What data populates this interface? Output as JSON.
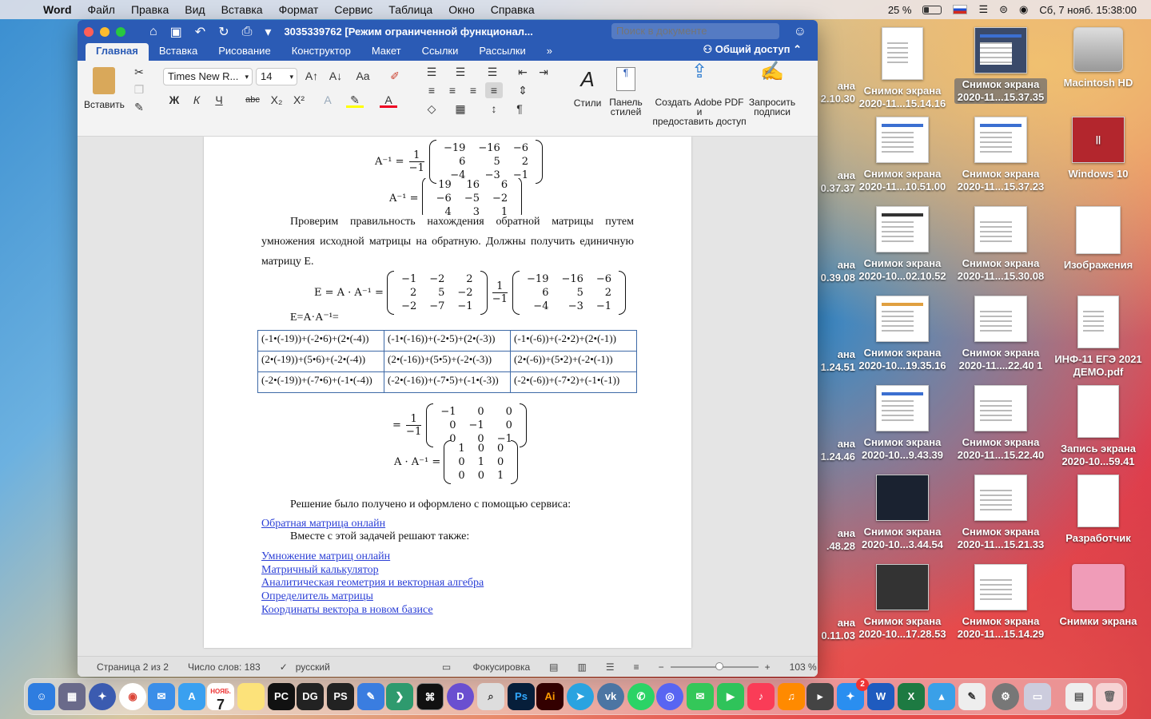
{
  "menubar": {
    "app": "Word",
    "items": [
      "Файл",
      "Правка",
      "Вид",
      "Вставка",
      "Формат",
      "Сервис",
      "Таблица",
      "Окно",
      "Справка"
    ],
    "battery": "25 %",
    "datetime": "Сб, 7 нояб.  15:38:00"
  },
  "window": {
    "title": "3035339762 [Режим ограниченной функционал...",
    "search_placeholder": "Поиск в документе"
  },
  "tabs": [
    "Главная",
    "Вставка",
    "Рисование",
    "Конструктор",
    "Макет",
    "Ссылки",
    "Рассылки"
  ],
  "share": "Общий доступ",
  "ribbon": {
    "paste": "Вставить",
    "font": "Times New R...",
    "size": "14",
    "bold": "Ж",
    "italic": "К",
    "underline": "Ч",
    "strike": "abc",
    "sub": "X₂",
    "sup": "X²",
    "styles": "Стили",
    "styles_pane_1": "Панель",
    "styles_pane_2": "стилей",
    "adobe_1": "Создать Adobe PDF и",
    "adobe_2": "предоставить доступ",
    "sign_1": "Запросить",
    "sign_2": "подписи"
  },
  "doc": {
    "m1_label": "A⁻¹ =",
    "frac1": {
      "num": "1",
      "den": "−1"
    },
    "m1": [
      [
        "−19",
        "−16",
        "−6"
      ],
      [
        "6",
        "5",
        "2"
      ],
      [
        "−4",
        "−3",
        "−1"
      ]
    ],
    "m2_label": "A⁻¹ =",
    "m2": [
      [
        "19",
        "16",
        "6"
      ],
      [
        "−6",
        "−5",
        "−2"
      ],
      [
        "4",
        "3",
        "1"
      ]
    ],
    "para1": "Проверим правильность нахождения обратной матрицы путем умножения исходной матрицы на обратную. Должны получить единичную матрицу E.",
    "m3_label": "E = A · A⁻¹ =",
    "m3a": [
      [
        "−1",
        "−2",
        "2"
      ],
      [
        "2",
        "5",
        "−2"
      ],
      [
        "−2",
        "−7",
        "−1"
      ]
    ],
    "m3b": [
      [
        "−19",
        "−16",
        "−6"
      ],
      [
        "6",
        "5",
        "2"
      ],
      [
        "−4",
        "−3",
        "−1"
      ]
    ],
    "eq_text": "E=A·A⁻¹=",
    "grid": [
      [
        "(-1•(-19))+(-2•6)+(2•(-4))",
        "(-1•(-16))+(-2•5)+(2•(-3))",
        "(-1•(-6))+(-2•2)+(2•(-1))"
      ],
      [
        "(2•(-19))+(5•6)+(-2•(-4))",
        "(2•(-16))+(5•5)+(-2•(-3))",
        "(2•(-6))+(5•2)+(-2•(-1))"
      ],
      [
        "(-2•(-19))+(-7•6)+(-1•(-4))",
        "(-2•(-16))+(-7•5)+(-1•(-3))",
        "(-2•(-6))+(-7•2)+(-1•(-1))"
      ]
    ],
    "m4_label": "=",
    "m4": [
      [
        "−1",
        "0",
        "0"
      ],
      [
        "0",
        "−1",
        "0"
      ],
      [
        "0",
        "0",
        "−1"
      ]
    ],
    "m5_label": "A · A⁻¹ =",
    "m5": [
      [
        "1",
        "0",
        "0"
      ],
      [
        "0",
        "1",
        "0"
      ],
      [
        "0",
        "0",
        "1"
      ]
    ],
    "para2": "Решение было получено и оформлено с помощью сервиса:",
    "link_main": "Обратная матрица онлайн",
    "para3": "Вместе с этой задачей решают также:",
    "links": [
      "Умножение матриц онлайн",
      "Матричный калькулятор",
      "Аналитическая геометрия и векторная алгебра",
      "Определитель матрицы",
      "Координаты вектора в новом базисе"
    ]
  },
  "status": {
    "page": "Страница 2 из 2",
    "words": "Число слов: 183",
    "lang": "русский",
    "focus": "Фокусировка",
    "zoom": "103 %"
  },
  "desktop": [
    {
      "l1": "Снимок экрана",
      "l2": "2020-11...15.14.16"
    },
    {
      "l1": "Снимок экрана",
      "l2": "2020-11...15.37.35"
    },
    {
      "l1": "Macintosh HD",
      "l2": ""
    },
    {
      "l1": "Снимок экрана",
      "l2": "2020-11...10.51.00"
    },
    {
      "l1": "Снимок экрана",
      "l2": "2020-11...15.37.23"
    },
    {
      "l1": "Windows 10",
      "l2": ""
    },
    {
      "l1": "Снимок экрана",
      "l2": "2020-10...02.10.52"
    },
    {
      "l1": "Снимок экрана",
      "l2": "2020-11...15.30.08"
    },
    {
      "l1": "Изображения",
      "l2": ""
    },
    {
      "l1": "Снимок экрана",
      "l2": "2020-10...19.35.16"
    },
    {
      "l1": "Снимок экрана",
      "l2": "2020-11....22.40 1"
    },
    {
      "l1": "ИНФ-11 ЕГЭ 2021",
      "l2": "ДЕМО.pdf"
    },
    {
      "l1": "Снимок экрана",
      "l2": "2020-10...9.43.39"
    },
    {
      "l1": "Снимок экрана",
      "l2": "2020-11...15.22.40"
    },
    {
      "l1": "Запись экрана",
      "l2": "2020-10...59.41"
    },
    {
      "l1": "Снимок экрана",
      "l2": "2020-10...3.44.54"
    },
    {
      "l1": "Снимок экрана",
      "l2": "2020-11...15.21.33"
    },
    {
      "l1": "Разработчик",
      "l2": ""
    },
    {
      "l1": "Снимок экрана",
      "l2": "2020-10...17.28.53"
    },
    {
      "l1": "Снимок экрана",
      "l2": "2020-11...15.14.29"
    },
    {
      "l1": "Снимки экрана",
      "l2": ""
    }
  ],
  "desktop_partial": [
    {
      "l1": "ана",
      "l2": "2.10.30"
    },
    {
      "l1": "ана",
      "l2": "0.37.37"
    },
    {
      "l1": "ана",
      "l2": "0.39.08"
    },
    {
      "l1": "ана",
      "l2": "1.24.51"
    },
    {
      "l1": "ана",
      "l2": "1.24.46"
    },
    {
      "l1": "ана",
      "l2": ".48.28"
    },
    {
      "l1": "ана",
      "l2": "0.11.03"
    }
  ],
  "dock": {
    "calendar_month": "НОЯБ.",
    "calendar_day": "7",
    "mail_badge": "2"
  }
}
